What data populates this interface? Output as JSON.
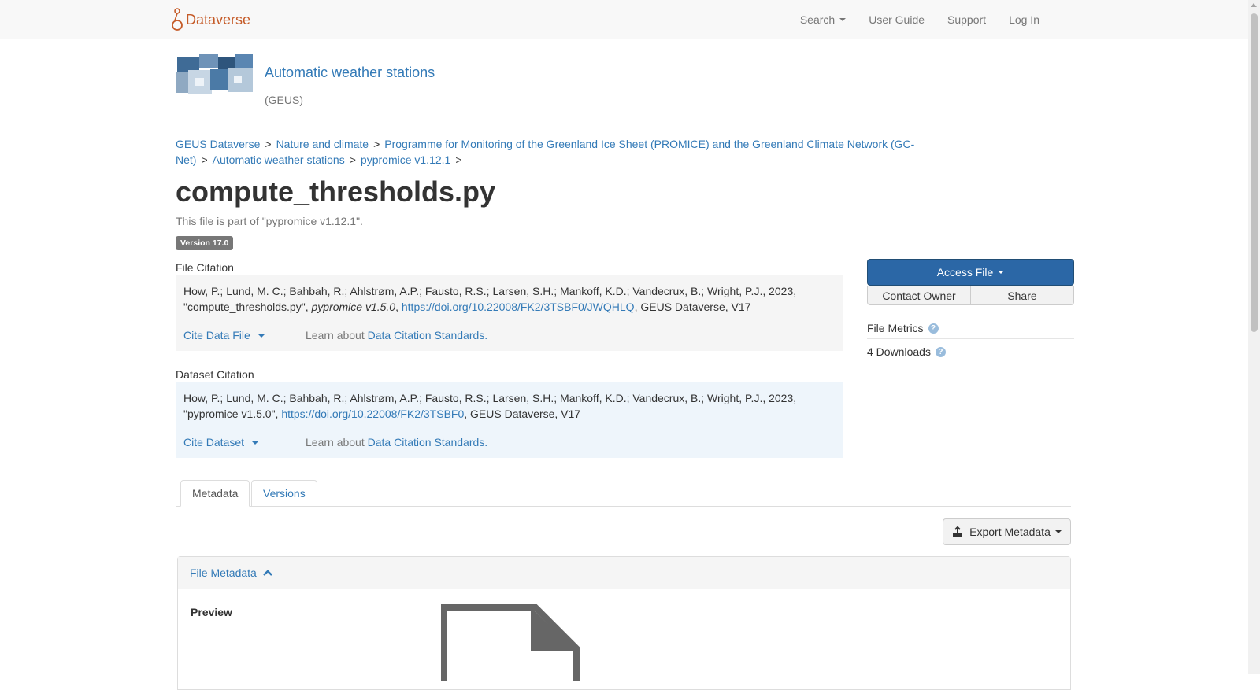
{
  "navbar": {
    "brand": "Dataverse",
    "links": [
      "Search",
      "User Guide",
      "Support",
      "Log In"
    ]
  },
  "collection": {
    "title": "Automatic weather stations",
    "affiliation": "(GEUS)"
  },
  "breadcrumb": {
    "items": [
      "GEUS Dataverse",
      "Nature and climate",
      "Programme for Monitoring of the Greenland Ice Sheet (PROMICE) and the Greenland Climate Network (GC-Net)",
      "Automatic weather stations",
      "pypromice v1.12.1"
    ],
    "separator": ">"
  },
  "file": {
    "title": "compute_thresholds.py",
    "part_of": "This file is part of \"pypromice v1.12.1\".",
    "version": "Version 17.0"
  },
  "file_citation": {
    "label": "File Citation",
    "authors": "How, P.; Lund, M. C.; Bahbah, R.; Ahlstrøm, A.P.; Fausto, R.S.; Larsen, S.H.; Mankoff, K.D.; Vandecrux, B.; Wright, P.J., 2023,",
    "title": "\"compute_thresholds.py\", ",
    "dataset_italic": "pypromice v1.5.0",
    "comma": ", ",
    "doi": "https://doi.org/10.22008/FK2/3TSBF0/JWQHLQ",
    "tail": ", GEUS Dataverse, V17",
    "cite_button": "Cite Data File",
    "learn_prefix": "Learn about ",
    "learn_link": "Data Citation Standards."
  },
  "dataset_citation": {
    "label": "Dataset Citation",
    "authors": "How, P.; Lund, M. C.; Bahbah, R.; Ahlstrøm, A.P.; Fausto, R.S.; Larsen, S.H.; Mankoff, K.D.; Vandecrux, B.; Wright, P.J., 2023,",
    "title": "\"pypromice v1.5.0\", ",
    "doi": "https://doi.org/10.22008/FK2/3TSBF0",
    "tail": ", GEUS Dataverse, V17",
    "cite_button": "Cite Dataset",
    "learn_prefix": "Learn about ",
    "learn_link": "Data Citation Standards."
  },
  "actions": {
    "access_file": "Access File",
    "contact_owner": "Contact Owner",
    "share": "Share"
  },
  "metrics": {
    "label": "File Metrics",
    "downloads": "4 Downloads"
  },
  "tabs": [
    "Metadata",
    "Versions"
  ],
  "export_metadata": "Export Metadata",
  "panel": {
    "title": "File Metadata",
    "preview_label": "Preview"
  },
  "colors": {
    "brand": "#c55b28",
    "link": "#337ab7",
    "primary": "#2b67a6"
  }
}
